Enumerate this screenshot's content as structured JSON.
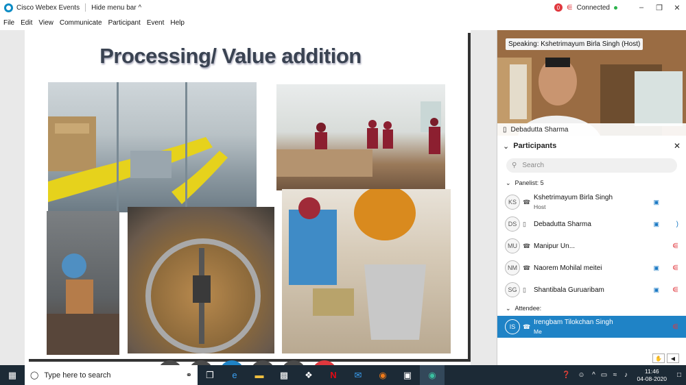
{
  "titlebar": {
    "app_title": "Cisco Webex Events",
    "hide_menu": "Hide menu bar ^",
    "status": "Connected",
    "record_label": "0"
  },
  "menu": [
    "File",
    "Edit",
    "View",
    "Communicate",
    "Participant",
    "Event",
    "Help"
  ],
  "slide": {
    "title": "Processing/ Value addition"
  },
  "video": {
    "speaking": "Speaking: Kshetrimayum Birla Singh (Host)",
    "name": "Debadutta Sharma"
  },
  "participants": {
    "header": "Participants",
    "search_placeholder": "Search",
    "panelist_label": "Panelist: 5",
    "attendee_label": "Attendee:",
    "panelists": [
      {
        "initials": "KS",
        "name": "Kshetrimayum Birla Singh",
        "role": "Host"
      },
      {
        "initials": "DS",
        "name": "Debadutta Sharma",
        "role": ""
      },
      {
        "initials": "MU",
        "name": "Manipur Un...",
        "role": ""
      },
      {
        "initials": "NM",
        "name": "Naorem Mohilal meitei",
        "role": ""
      },
      {
        "initials": "SG",
        "name": "Shantibala Guruaribam",
        "role": ""
      }
    ],
    "attendees": [
      {
        "initials": "IS",
        "name": "Irengbam Tilokchan Singh",
        "role": "Me"
      }
    ]
  },
  "taskbar": {
    "search_placeholder": "Type here to search",
    "time": "11:46",
    "date": "04-08-2020"
  },
  "colors": {
    "accent": "#1f83c6",
    "end": "#e0383e",
    "dark": "#1c2a36"
  }
}
